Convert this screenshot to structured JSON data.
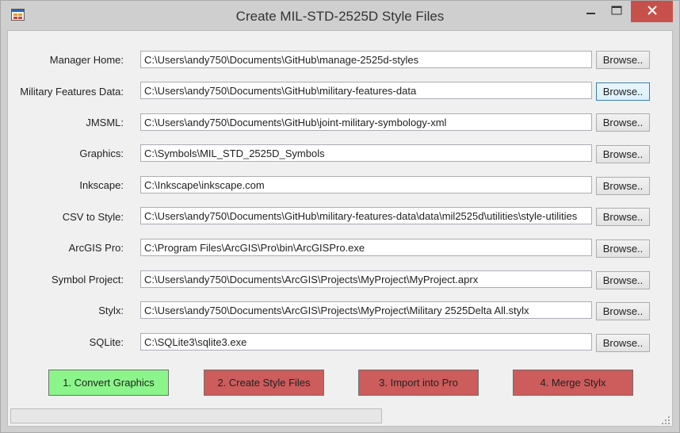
{
  "window": {
    "title": "Create MIL-STD-2525D Style Files",
    "icon": "app-window-icon",
    "controls": [
      "minimize-icon",
      "maximize-icon",
      "close-icon"
    ]
  },
  "fields": [
    {
      "label": "Manager Home:",
      "value": "C:\\Users\\andy750\\Documents\\GitHub\\manage-2525d-styles",
      "button": "Browse.."
    },
    {
      "label": "Military Features Data:",
      "value": "C:\\Users\\andy750\\Documents\\GitHub\\military-features-data",
      "button": "Browse.."
    },
    {
      "label": "JMSML:",
      "value": "C:\\Users\\andy750\\Documents\\GitHub\\joint-military-symbology-xml",
      "button": "Browse.."
    },
    {
      "label": "Graphics:",
      "value": "C:\\Symbols\\MIL_STD_2525D_Symbols",
      "button": "Browse.."
    },
    {
      "label": "Inkscape:",
      "value": "C:\\Inkscape\\inkscape.com",
      "button": "Browse.."
    },
    {
      "label": "CSV to Style:",
      "value": "C:\\Users\\andy750\\Documents\\GitHub\\military-features-data\\data\\mil2525d\\utilities\\style-utilities",
      "button": "Browse.."
    },
    {
      "label": "ArcGIS Pro:",
      "value": "C:\\Program Files\\ArcGIS\\Pro\\bin\\ArcGISPro.exe",
      "button": "Browse.."
    },
    {
      "label": "Symbol Project:",
      "value": "C:\\Users\\andy750\\Documents\\ArcGIS\\Projects\\MyProject\\MyProject.aprx",
      "button": "Browse.."
    },
    {
      "label": "Stylx:",
      "value": "C:\\Users\\andy750\\Documents\\ArcGIS\\Projects\\MyProject\\Military 2525Delta All.stylx",
      "button": "Browse.."
    },
    {
      "label": "SQLite:",
      "value": "C:\\SQLite3\\sqlite3.exe",
      "button": "Browse.."
    }
  ],
  "actions": [
    {
      "label": "1. Convert Graphics",
      "color": "#8bf58b"
    },
    {
      "label": "2. Create Style Files",
      "color": "#cd5c5c"
    },
    {
      "label": "3. Import into Pro",
      "color": "#cd5c5c"
    },
    {
      "label": "4. Merge Stylx",
      "color": "#cd5c5c"
    }
  ],
  "progress": {
    "value": 0
  }
}
